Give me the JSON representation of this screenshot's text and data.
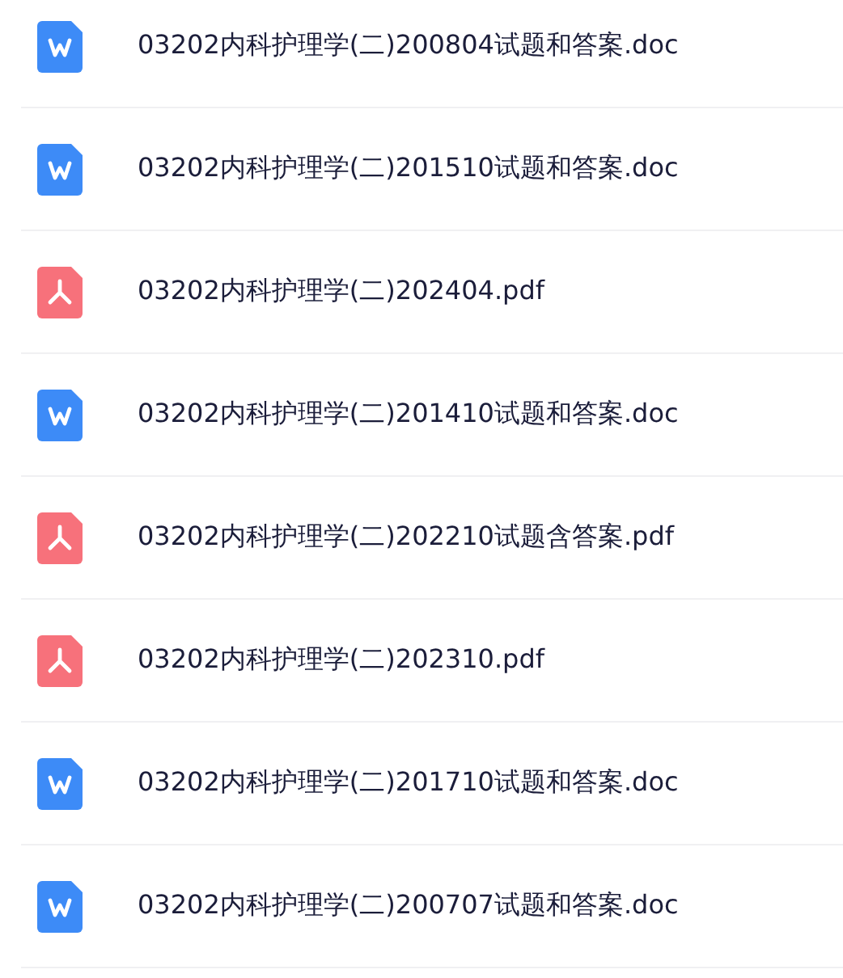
{
  "files": [
    {
      "kind": "word",
      "name": "03202内科护理学(二)200804试题和答案.doc"
    },
    {
      "kind": "word",
      "name": "03202内科护理学(二)201510试题和答案.doc"
    },
    {
      "kind": "pdf",
      "name": "03202内科护理学(二)202404.pdf"
    },
    {
      "kind": "word",
      "name": "03202内科护理学(二)201410试题和答案.doc"
    },
    {
      "kind": "pdf",
      "name": "03202内科护理学(二)202210试题含答案.pdf"
    },
    {
      "kind": "pdf",
      "name": "03202内科护理学(二)202310.pdf"
    },
    {
      "kind": "word",
      "name": "03202内科护理学(二)201710试题和答案.doc"
    },
    {
      "kind": "word",
      "name": "03202内科护理学(二)200707试题和答案.doc"
    }
  ]
}
